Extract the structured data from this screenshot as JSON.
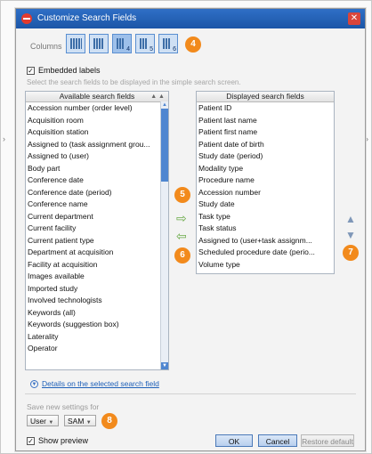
{
  "window": {
    "title": "Customize Search Fields",
    "close_glyph": "✕"
  },
  "columns": {
    "label": "Columns",
    "options": [
      {
        "label": ""
      },
      {
        "label": ""
      },
      {
        "label": "4"
      },
      {
        "label": "5"
      },
      {
        "label": "6"
      }
    ],
    "selected_index": 2
  },
  "embedded_labels": {
    "label": "Embedded labels",
    "checked": true
  },
  "instruction": "Select the search fields to be displayed in the simple search screen.",
  "available": {
    "header": "Available search fields",
    "items": [
      "Accession number (order level)",
      "Acquisition room",
      "Acquisition station",
      "Assigned to (task assignment grou...",
      "Assigned to (user)",
      "Body part",
      "Conference date",
      "Conference date (period)",
      "Conference name",
      "Current department",
      "Current facility",
      "Current patient type",
      "Department at acquisition",
      "Facility at acquisition",
      "Images available",
      "Imported study",
      "Involved technologists",
      "Keywords (all)",
      "Keywords (suggestion box)",
      "Laterality",
      "Operator"
    ]
  },
  "displayed": {
    "header": "Displayed search fields",
    "items": [
      "Patient ID",
      "Patient last name",
      "Patient first name",
      "Patient date of birth",
      "Study date (period)",
      "Modality type",
      "Procedure name",
      "Accession number",
      "Study date",
      "Task type",
      "Task status",
      "Assigned to (user+task assignm...",
      "Scheduled procedure date (perio...",
      "Volume type"
    ]
  },
  "badges": {
    "b4": "4",
    "b5": "5",
    "b6": "6",
    "b7": "7",
    "b8": "8"
  },
  "details_link": "Details on the selected search field",
  "save_settings": {
    "label": "Save new settings for",
    "scope": "User",
    "user": "SAM"
  },
  "show_preview": {
    "label": "Show preview",
    "checked": true
  },
  "buttons": {
    "ok": "OK",
    "cancel": "Cancel",
    "restore": "Restore default"
  },
  "icons": {
    "add": "arrow-right-icon",
    "remove": "arrow-left-icon",
    "up": "triangle-up-icon",
    "down": "triangle-down-icon"
  },
  "colors": {
    "titlebar": "#1c56a7",
    "badge": "#f28a1c",
    "scroll_thumb": "#4f86d0"
  }
}
